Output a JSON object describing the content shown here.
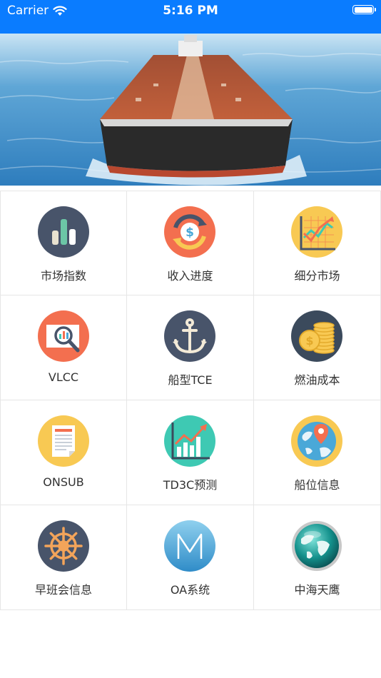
{
  "status_bar": {
    "carrier": "Carrier",
    "time": "5:16 PM",
    "wifi_icon": "wifi-icon",
    "battery_icon": "battery-icon"
  },
  "banner": {
    "image": "oil-tanker-photo"
  },
  "menu": [
    {
      "label": "市场指数",
      "icon": "bar-chart-icon",
      "color": "#48546a"
    },
    {
      "label": "收入进度",
      "icon": "dollar-cycle-icon",
      "color": "#f36f4f"
    },
    {
      "label": "细分市场",
      "icon": "line-chart-grid-icon",
      "color": "#f8c953"
    },
    {
      "label": "VLCC",
      "icon": "magnifier-chart-icon",
      "color": "#f36f4f"
    },
    {
      "label": "船型TCE",
      "icon": "anchor-icon",
      "color": "#48546a"
    },
    {
      "label": "燃油成本",
      "icon": "coin-stack-icon",
      "color": "#3b4a5c"
    },
    {
      "label": "ONSUB",
      "icon": "document-icon",
      "color": "#f8c953"
    },
    {
      "label": "TD3C预测",
      "icon": "trend-chart-icon",
      "color": "#3ec9b3"
    },
    {
      "label": "船位信息",
      "icon": "globe-pin-icon",
      "color": "#f8c953"
    },
    {
      "label": "早班会信息",
      "icon": "ship-wheel-icon",
      "color": "#48546a"
    },
    {
      "label": "OA系统",
      "icon": "letter-m-icon",
      "color": "#4aa8d8"
    },
    {
      "label": "中海天鹰",
      "icon": "globe-icon",
      "color": "#1aa6a0"
    }
  ]
}
